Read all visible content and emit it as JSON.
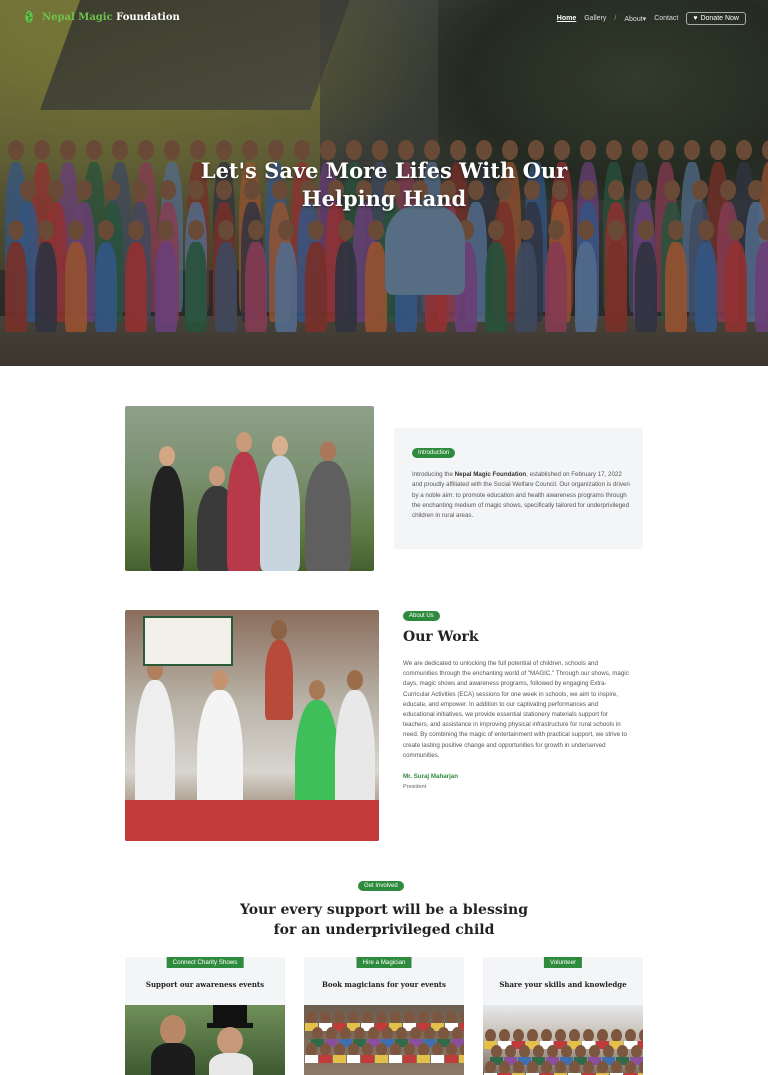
{
  "nav": {
    "logo_green": "Nepal Magic",
    "logo_white": " Foundation",
    "items": [
      "Home",
      "Gallery",
      "About",
      "Contact"
    ],
    "separator": "/",
    "donate": "Donate Now"
  },
  "hero": {
    "title_line1": "Let's Save More Lifes With Our",
    "title_line2": "Helping Hand"
  },
  "intro": {
    "pill": "Introduction",
    "text_before": "Introducing the ",
    "org": "Nepal Magic Foundation",
    "text_after": ", established on February 17, 2022 and proudly affiliated with the Social Welfare Council. Our organization is driven by a noble aim: to promote education and health awareness programs through the enchanting medium of magic shows, specifically tailored for underprivileged children in rural areas."
  },
  "about": {
    "pill": "About Us",
    "title": "Our Work",
    "text": "We are dedicated to unlocking the full potential of children, schools and communities through the enchanting world of \"MAGIC.\" Through our shows, magic days, magic shows and awareness programs, followed by engaging Extra-Curricular Activities (ECA) sessions for one week in schools, we aim to inspire, educate, and empower. In addition to our captivating performances and educational initiatives, we provide essential stationery materials support for teachers, and assistance in improving physical infrastructure for rural schools in need. By combining the magic of entertainment with practical support, we strive to create lasting positive change and opportunities for growth in underserved communities.",
    "signer": "Mr. Suraj Maharjan",
    "role": "President"
  },
  "involve": {
    "pill": "Get Involved",
    "title_line1": "Your every support will be a blessing",
    "title_line2": "for an underprivileged child",
    "cards": [
      {
        "tag": "Connect Charity Shows",
        "title": "Support our awareness events"
      },
      {
        "tag": "Hire a Magician",
        "title": "Book magicians for your events"
      },
      {
        "tag": "Volunteer",
        "title": "Share your skills and knowledge"
      }
    ]
  },
  "colors": {
    "accent": "#2e8b3d",
    "logo_green": "#6cc24a"
  }
}
